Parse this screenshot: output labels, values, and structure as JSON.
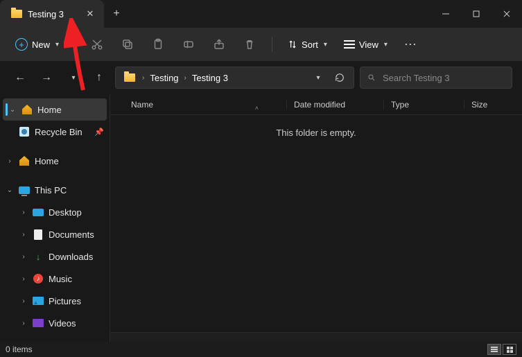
{
  "tab": {
    "label": "Testing 3"
  },
  "toolbar": {
    "new": "New",
    "sort": "Sort",
    "view": "View"
  },
  "breadcrumbs": {
    "a": "Testing",
    "b": "Testing 3"
  },
  "search": {
    "placeholder": "Search Testing 3"
  },
  "nav": {
    "home": "Home",
    "recycle": "Recycle Bin",
    "home2": "Home",
    "thispc": "This PC",
    "desktop": "Desktop",
    "documents": "Documents",
    "downloads": "Downloads",
    "music": "Music",
    "pictures": "Pictures",
    "videos": "Videos"
  },
  "columns": {
    "name": "Name",
    "date": "Date modified",
    "type": "Type",
    "size": "Size"
  },
  "content": {
    "empty": "This folder is empty."
  },
  "status": {
    "count": "0 items"
  }
}
